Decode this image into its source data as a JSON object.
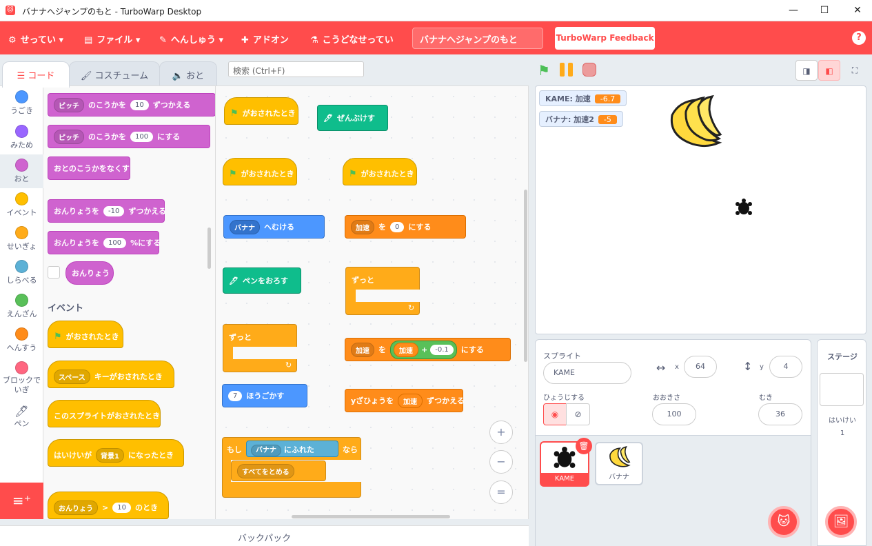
{
  "window": {
    "title": "バナナへジャンプのもと - TurboWarp Desktop",
    "minimize": "—",
    "maximize": "☐",
    "close": "✕",
    "icon": "🐱"
  },
  "menu": {
    "settings": "せってい",
    "file": "ファイル",
    "edit": "へんしゅう",
    "addons": "アドオン",
    "custom": "こうどなせってい",
    "project_title": "バナナへジャンプのもと",
    "feedback": "TurboWarp Feedback",
    "help": "?"
  },
  "tabs": {
    "code": "コード",
    "costume": "コスチューム",
    "sound": "おと"
  },
  "search": {
    "placeholder": "検索 (Ctrl+F)"
  },
  "categories": [
    {
      "label": "うごき",
      "color": "#4c97ff"
    },
    {
      "label": "みため",
      "color": "#9966ff"
    },
    {
      "label": "おと",
      "color": "#cf63cf"
    },
    {
      "label": "イベント",
      "color": "#ffbf00"
    },
    {
      "label": "せいぎょ",
      "color": "#ffab19"
    },
    {
      "label": "しらべる",
      "color": "#5cb1d6"
    },
    {
      "label": "えんざん",
      "color": "#59c059"
    },
    {
      "label": "へんすう",
      "color": "#ff8c1a"
    },
    {
      "label": "ブロックでいぎ",
      "color": "#ff6680"
    },
    {
      "label": "ペン",
      "color": "#0fbd8c"
    }
  ],
  "palette": {
    "pitch_dd": "ピッチ",
    "change_pitch": "のこうかを",
    "val10": "10",
    "by": "ずつかえる",
    "set_pitch": "のこうかを",
    "val100": "100",
    "set_to": "にする",
    "clear_fx": "おとのこうかをなくす",
    "vol_label": "おんりょうを",
    "vol_neg10": "-10",
    "vol_by": "ずつかえる",
    "vol_set": "おんりょうを",
    "vol100": "100",
    "vol_pct": "%にする",
    "volume": "おんりょう",
    "events_heading": "イベント",
    "flag_clicked": "がおされたとき",
    "key_dd": "スペース",
    "key_pressed": "キーがおされたとき",
    "sprite_clicked": "このスプライトがおされたとき",
    "backdrop_when": "はいけいが",
    "backdrop_dd": "背景1",
    "backdrop_switch": "になったとき",
    "gt_dd": "おんりょう",
    "gt": ">",
    "gt_val": "10",
    "gt_when": "のとき"
  },
  "workspace": {
    "flag_clicked": "がおされたとき",
    "erase_all": "ぜんぶけす",
    "point_dd": "バナナ",
    "point_towards": "へむける",
    "pen_down": "ペンをおろす",
    "forever": "ずっと",
    "var_dd": "加速",
    "set_label": "を",
    "zero": "0",
    "set_to": "にする",
    "move_val": "7",
    "move_steps": "ほうごかす",
    "change_by_to": "を",
    "accel": "加速",
    "plus": "+",
    "neg01": "-0.1",
    "change_y": "yざひょうを",
    "y_by": "ずつかえる",
    "if": "もし",
    "touching_dd": "バナナ",
    "touching": "にふれた",
    "then": "なら",
    "stop_all": "すべてをとめる",
    "zoom_in": "+",
    "zoom_out": "−",
    "zoom_reset": "="
  },
  "backpack": "バックパック",
  "monitors": [
    {
      "label": "KAME: 加速",
      "value": "-6.7"
    },
    {
      "label": "バナナ: 加速2",
      "value": "-5"
    }
  ],
  "sprite_info": {
    "sprite_label": "スプライト",
    "name": "KAME",
    "x_label": "x",
    "x": "64",
    "y_label": "y",
    "y": "4",
    "show_label": "ひょうじする",
    "size_label": "おおきさ",
    "size": "100",
    "direction_label": "むき",
    "direction": "36"
  },
  "sprites": [
    {
      "name": "KAME"
    },
    {
      "name": "バナナ"
    }
  ],
  "stage_pane": {
    "title": "ステージ",
    "backdrops_label": "はいけい",
    "backdrops_count": "1"
  },
  "colors": {
    "accent": "#ff4c4c",
    "sound": "#cf63cf",
    "events": "#ffbf00",
    "control": "#ffab19",
    "motion": "#4c97ff",
    "variables": "#ff8c1a",
    "pen": "#0fbd8c"
  }
}
